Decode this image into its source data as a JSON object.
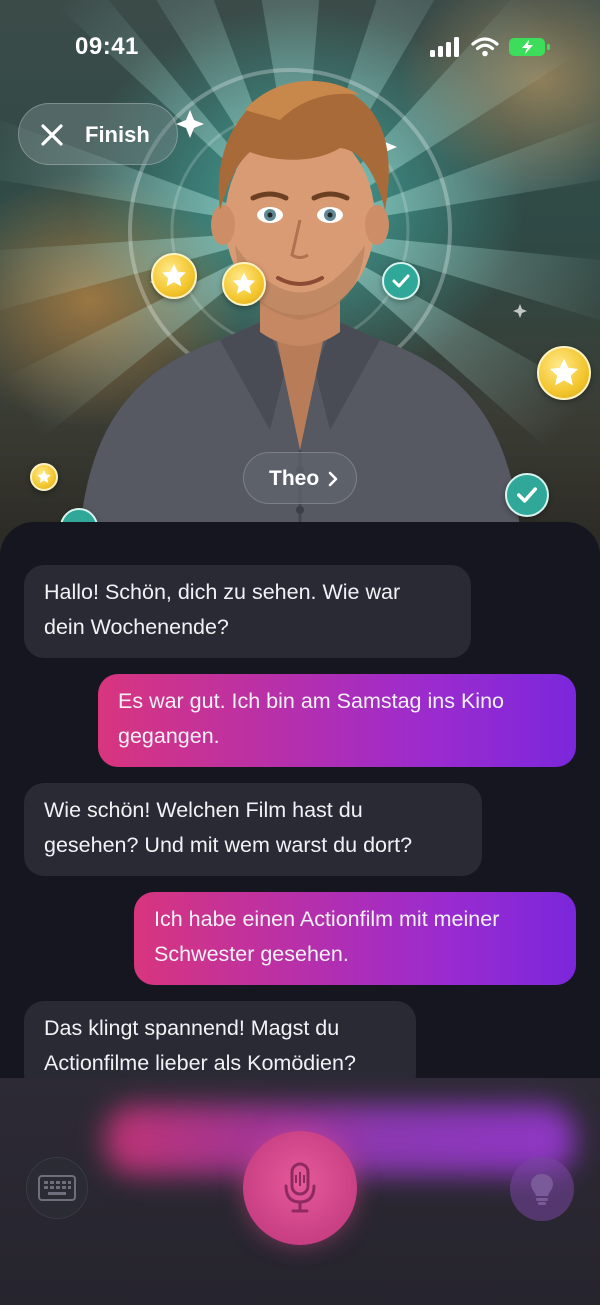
{
  "status_bar": {
    "time": "09:41"
  },
  "header": {
    "finish_label": "Finish",
    "character_name": "Theo"
  },
  "messages": [
    {
      "role": "ai",
      "text_line1": "Hallo! Schön, dich zu sehen. Wie war",
      "text_line2": "dein Wochenende?"
    },
    {
      "role": "user",
      "text_line1": "Es war gut. Ich bin am Samstag ins Kino",
      "text_line2": "gegangen."
    },
    {
      "role": "ai",
      "text_line1": "Wie schön! Welchen Film hast du",
      "text_line2": "gesehen? Und mit wem warst du dort?"
    },
    {
      "role": "user",
      "text_line1": "Ich habe einen Actionfilm mit meiner",
      "text_line2": "Schwester gesehen."
    },
    {
      "role": "ai",
      "text_line1": "Das klingt spannend! Magst du",
      "text_line2": "Actionfilme lieber als Komödien?"
    }
  ],
  "controls": {
    "keyboard_icon": "keyboard-icon",
    "mic_icon": "microphone-icon",
    "hint_icon": "lightbulb-icon"
  },
  "colors": {
    "accent_pink": "#d8357e",
    "accent_purple": "#7b27db",
    "ai_bubble": "#2a2a35",
    "chat_bg": "#161620",
    "battery": "#3ddc5a"
  }
}
